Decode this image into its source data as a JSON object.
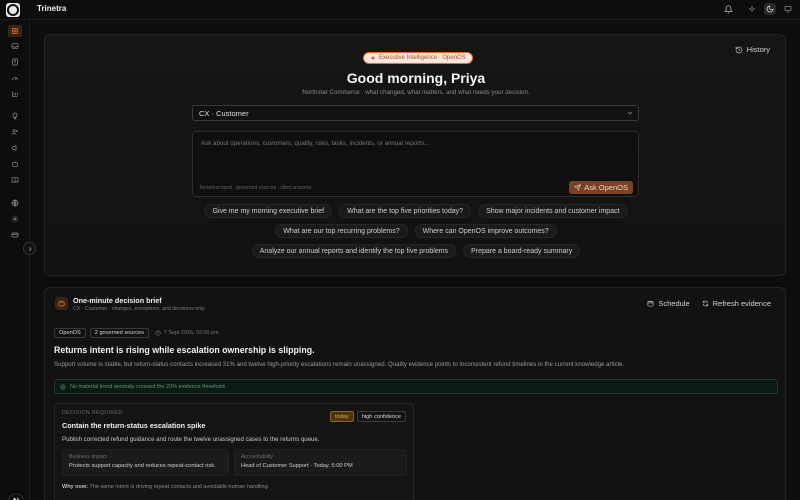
{
  "app": {
    "brand": "Trinetra",
    "avatar_initial": "N"
  },
  "history_label": "History",
  "hero": {
    "pill": "Executive Intelligence · OpenOS",
    "greeting": "Good morning, Priya",
    "subtitle": "Northstar Commerce · what changed, what matters, and what needs your decision.",
    "select_value": "CX · Customer",
    "ask_placeholder": "Ask about operations, customers, quality, risks, tasks, incidents, or annual reports...",
    "ask_footer": "Tenant-scoped · governed sources · cited answers",
    "ask_button": "Ask OpenOS",
    "chips_row1": [
      "Give me my morning executive brief",
      "What are the top five priorities today?",
      "Show major incidents and customer impact"
    ],
    "chips_row2": [
      "What are our top recurring problems?",
      "Where can OpenOS improve outcomes?"
    ],
    "chips_row3": [
      "Analyze our annual reports and identify the top five problems",
      "Prepare a board-ready summary"
    ]
  },
  "brief": {
    "title": "One-minute decision brief",
    "subtitle": "CX · Customer · changes, exceptions, and decisions only",
    "schedule": "Schedule",
    "refresh": "Refresh evidence",
    "tag_source": "OpenOS",
    "tag_count": "2 governed sources",
    "timestamp": "7 Sept 2026, 02:00 pm",
    "headline": "Returns intent is rising while escalation ownership is slipping.",
    "summary": "Support volume is stable, but return-status contacts increased 31% and twelve high-priority escalations remain unassigned. Quality evidence points to inconsistent refund timelines in the current knowledge article.",
    "alert": "No material trend anomaly crossed the 20% evidence threshold.",
    "decision": {
      "label": "DECISION REQUIRED",
      "title": "Contain the return-status escalation spike",
      "badge_urgency": "today",
      "badge_confidence": "high confidence",
      "text": "Publish corrected refund guidance and route the twelve unassigned cases to the returns queue.",
      "impact_key": "Business impact",
      "impact_value": "Protects support capacity and reduces repeat-contact risk.",
      "owner_key": "Accountability",
      "owner_value": "Head of Customer Support · Today, 5:00 PM",
      "why_label": "Why now:",
      "why_text": " The same intent is driving repeat contacts and avoidable human handling."
    }
  },
  "colors": {
    "accent": "#e06b3a",
    "background": "#0d0d0d",
    "card": "#121212",
    "success_text": "#5c9b7a",
    "warning": "#e9b04f"
  },
  "icons": [
    "logo-icon",
    "bell-icon",
    "sun-icon",
    "moon-icon",
    "monitor-icon",
    "history-icon",
    "sparkle-icon",
    "chevron-down-icon",
    "send-icon",
    "briefcase-icon",
    "calendar-icon",
    "refresh-icon",
    "clock-icon",
    "check-circle-icon",
    "chevron-right-icon"
  ]
}
